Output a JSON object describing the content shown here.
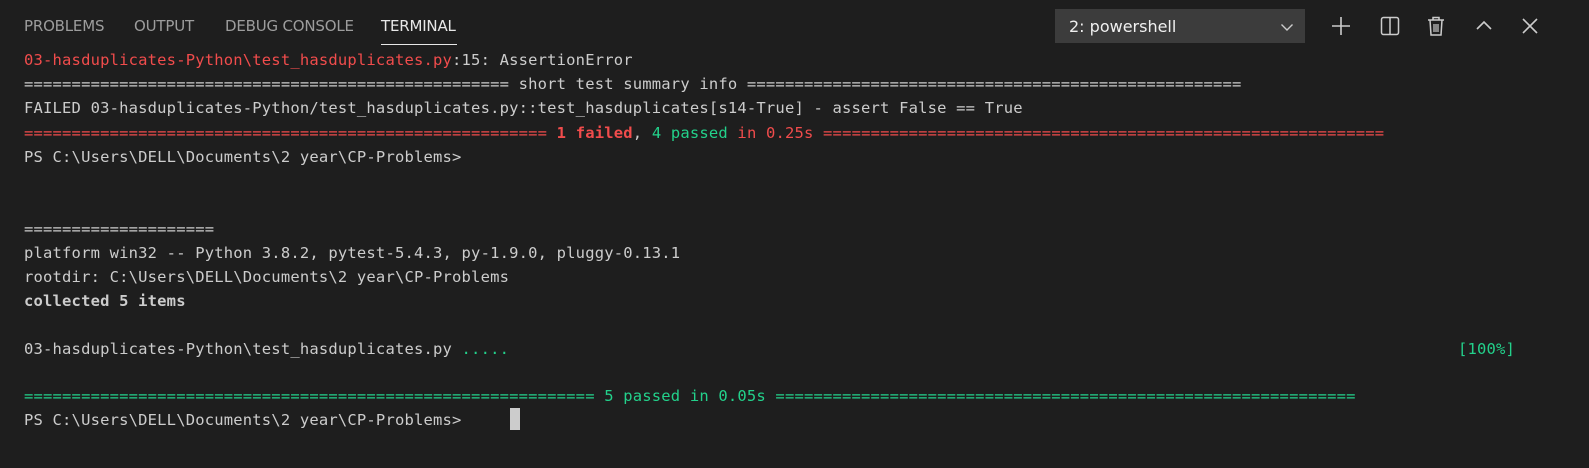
{
  "tabs": [
    {
      "label": "PROBLEMS",
      "active": false
    },
    {
      "label": "OUTPUT",
      "active": false
    },
    {
      "label": "DEBUG CONSOLE",
      "active": false
    },
    {
      "label": "TERMINAL",
      "active": true
    }
  ],
  "terminal_select": {
    "value": "2: powershell"
  },
  "actions": [
    {
      "name": "new-terminal",
      "icon": "plus-icon"
    },
    {
      "name": "split-terminal",
      "icon": "split-icon"
    },
    {
      "name": "kill-terminal",
      "icon": "trash-icon"
    },
    {
      "name": "maximize-panel",
      "icon": "chevron-up-icon"
    },
    {
      "name": "close-panel",
      "icon": "close-icon"
    }
  ],
  "colors": {
    "background": "#1e1e1e",
    "text": "#cccccc",
    "error_red": "#f14c4c",
    "success_green": "#23d18b",
    "select_bg": "#3c3c3c"
  },
  "terminal": {
    "l1_path": "03-hasduplicates-Python\\test_hasduplicates.py",
    "l1_rest": ":15: AssertionError",
    "l2": "=================================================== short test summary info ====================================================",
    "l3": "FAILED 03-hasduplicates-Python/test_hasduplicates.py::test_hasduplicates[s14-True] - assert False == True",
    "l4_pre": "======================================================= ",
    "l4_failed": "1 failed",
    "l4_comma": ", ",
    "l4_passed": "4 passed",
    "l4_post": " in 0.25s ===========================================================",
    "l5": "PS C:\\Users\\DELL\\Documents\\2 year\\CP-Problems>",
    "l6": "====================",
    "l7": "platform win32 -- Python 3.8.2, pytest-5.4.3, py-1.9.0, pluggy-0.13.1",
    "l8": "rootdir: C:\\Users\\DELL\\Documents\\2 year\\CP-Problems",
    "l9": "collected 5 items",
    "l10_file": "03-hasduplicates-Python\\test_hasduplicates.py ",
    "l10_dots": ".....",
    "l10_pct": "[100%]",
    "l11": "============================================================ 5 passed in 0.05s =============================================================",
    "l12": "PS C:\\Users\\DELL\\Documents\\2 year\\CP-Problems> "
  }
}
